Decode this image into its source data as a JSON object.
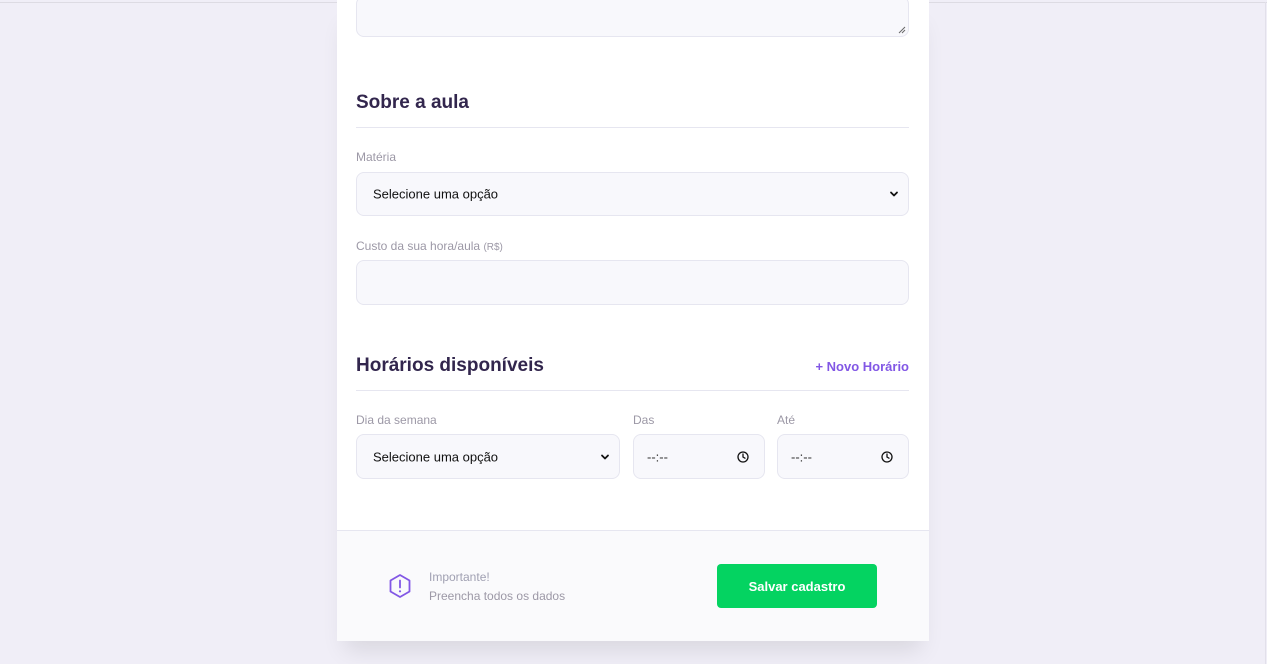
{
  "section_about": {
    "title": "Sobre a aula"
  },
  "subject": {
    "label": "Matéria",
    "value": "Selecione uma opção"
  },
  "cost": {
    "label": "Custo da sua hora/aula",
    "unit": "(R$)",
    "value": ""
  },
  "schedule": {
    "title": "Horários disponíveis",
    "add_label": "+ Novo Horário",
    "weekday": {
      "label": "Dia da semana",
      "value": "Selecione uma opção"
    },
    "from": {
      "label": "Das",
      "value": "--:--"
    },
    "to": {
      "label": "Até",
      "value": "--:--"
    }
  },
  "footer": {
    "note_title": "Importante!",
    "note_text": "Preencha todos os dados",
    "save_label": "Salvar cadastro"
  },
  "colors": {
    "primary": "#8257e5",
    "title": "#32264d",
    "success": "#04d361",
    "background": "#f0eef7"
  },
  "icons": [
    "chevron-down-icon",
    "clock-icon",
    "warning-icon"
  ]
}
